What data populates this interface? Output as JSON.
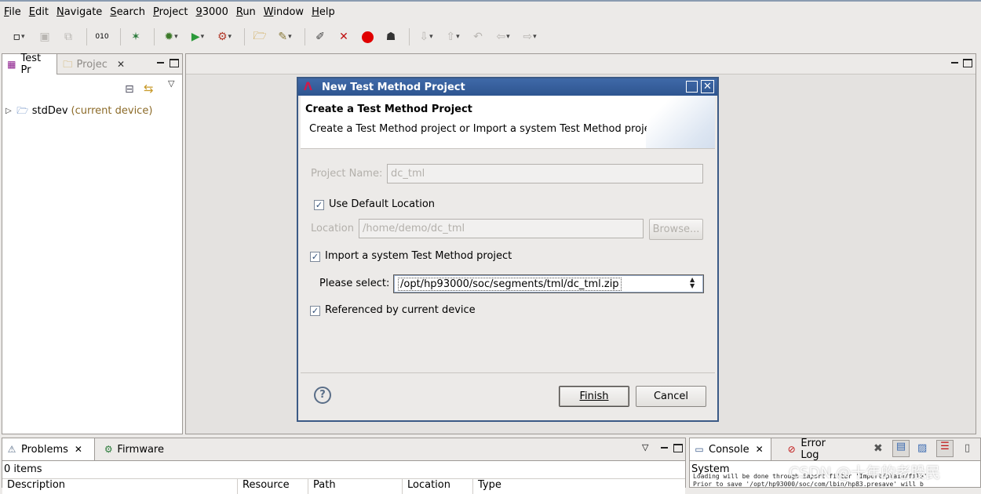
{
  "menu": [
    "File",
    "Edit",
    "Navigate",
    "Search",
    "Project",
    "93000",
    "Run",
    "Window",
    "Help"
  ],
  "left_panel": {
    "tabs": [
      {
        "label": "Test Pr",
        "active": true
      },
      {
        "label": "Projec",
        "active": false
      }
    ],
    "tree": {
      "name": "stdDev",
      "annotation": "(current device)"
    }
  },
  "dialog": {
    "title": "New Test Method Project",
    "heading": "Create a Test Method Project",
    "description": "Create a Test Method project or Import a system Test Method project",
    "project_name_label": "Project Name:",
    "project_name_value": "dc_tml",
    "use_default_location_label": "Use Default Location",
    "use_default_location_checked": true,
    "location_label": "Location",
    "location_value": "/home/demo/dc_tml",
    "browse_label": "Browse...",
    "import_label": "Import a system Test Method project",
    "import_checked": true,
    "please_select_label": "Please select:",
    "please_select_value": "/opt/hp93000/soc/segments/tml/dc_tml.zip",
    "referenced_label": "Referenced by current device",
    "referenced_checked": true,
    "help_label": "?",
    "finish_label": "Finish",
    "cancel_label": "Cancel"
  },
  "bottom_left": {
    "tabs": [
      "Problems",
      "Firmware"
    ],
    "count_text": "0 items",
    "columns": [
      "Description",
      "Resource",
      "Path",
      "Location",
      "Type"
    ]
  },
  "bottom_right": {
    "tabs": [
      "Console",
      "Error Log"
    ],
    "console_label": "System",
    "console_lines": [
      "Loading will be done through import filter 'Import/plain/file'.",
      "Prior to save '/opt/hp93000/soc/com/lbin/hp83.presave' will b"
    ]
  },
  "watermark": "CSDN @十年的老股民",
  "colors": {
    "title_bar": "#2e5590",
    "annotation": "#8c6b29",
    "stop_button": "#e00000"
  }
}
